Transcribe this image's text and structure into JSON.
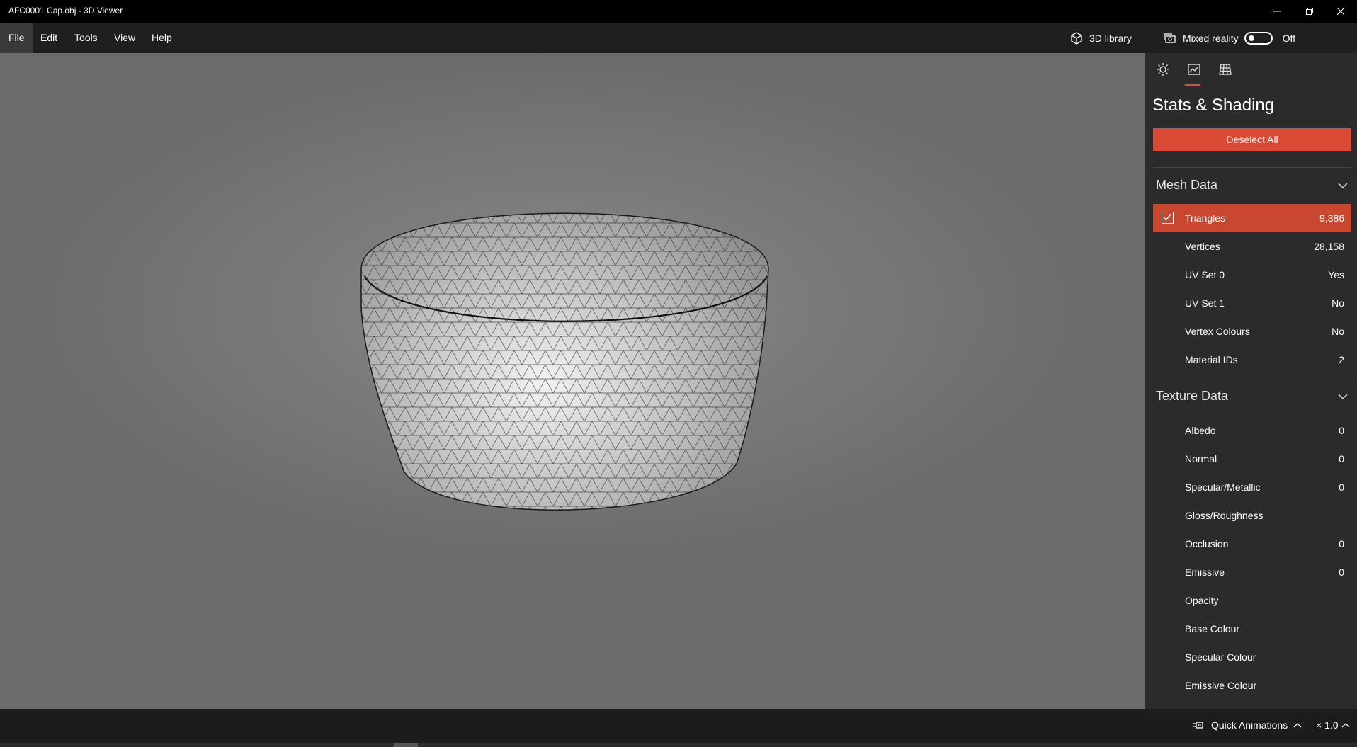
{
  "window": {
    "title": "AFC0001 Cap.obj - 3D Viewer"
  },
  "menu": {
    "items": [
      "File",
      "Edit",
      "Tools",
      "View",
      "Help"
    ]
  },
  "toolbar": {
    "library_label": "3D library",
    "mixed_reality_label": "Mixed reality",
    "mixed_reality_state": "Off"
  },
  "panel": {
    "title": "Stats & Shading",
    "deselect_label": "Deselect All",
    "mesh_section": "Mesh Data",
    "mesh_rows": [
      {
        "label": "Triangles",
        "value": "9,386",
        "checked": true
      },
      {
        "label": "Vertices",
        "value": "28,158"
      },
      {
        "label": "UV Set 0",
        "value": "Yes"
      },
      {
        "label": "UV Set 1",
        "value": "No"
      },
      {
        "label": "Vertex Colours",
        "value": "No"
      },
      {
        "label": "Material IDs",
        "value": "2"
      }
    ],
    "texture_section": "Texture Data",
    "texture_rows": [
      {
        "label": "Albedo",
        "value": "0"
      },
      {
        "label": "Normal",
        "value": "0"
      },
      {
        "label": "Specular/Metallic",
        "value": "0"
      },
      {
        "label": "Gloss/Roughness",
        "value": ""
      },
      {
        "label": "Occlusion",
        "value": "0"
      },
      {
        "label": "Emissive",
        "value": "0"
      },
      {
        "label": "Opacity",
        "value": ""
      },
      {
        "label": "Base Colour",
        "value": ""
      },
      {
        "label": "Specular Colour",
        "value": ""
      },
      {
        "label": "Emissive Colour",
        "value": ""
      }
    ]
  },
  "bottom": {
    "quick_animations": "Quick Animations",
    "speed": "× 1.0"
  },
  "colors": {
    "accent": "#d84a33",
    "viewport_bg": "#7b7b7b",
    "panel_bg": "#2b2b2b"
  }
}
